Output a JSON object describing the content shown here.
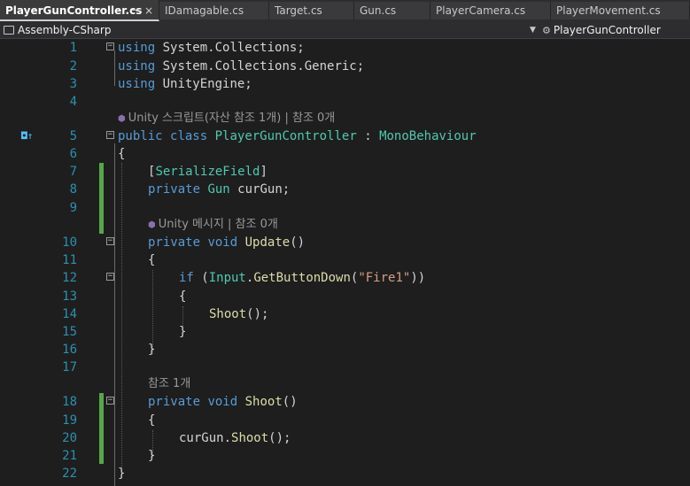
{
  "tabs": [
    {
      "label": "PlayerGunController.cs",
      "active": true,
      "pin": "⊸",
      "close": "×"
    },
    {
      "label": "IDamagable.cs"
    },
    {
      "label": "Target.cs"
    },
    {
      "label": "Gun.cs"
    },
    {
      "label": "PlayerCamera.cs"
    },
    {
      "label": "PlayerMovement.cs"
    }
  ],
  "navbar": {
    "project": "Assembly-CSharp",
    "class_member": "PlayerGunController"
  },
  "editor": {
    "lines": [
      {
        "n": "1"
      },
      {
        "n": "2"
      },
      {
        "n": "3"
      },
      {
        "n": "4"
      },
      {
        "n": "5"
      },
      {
        "n": "6"
      },
      {
        "n": "7"
      },
      {
        "n": "8"
      },
      {
        "n": "9"
      },
      {
        "n": "10"
      },
      {
        "n": "11"
      },
      {
        "n": "12"
      },
      {
        "n": "13"
      },
      {
        "n": "14"
      },
      {
        "n": "15"
      },
      {
        "n": "16"
      },
      {
        "n": "17"
      },
      {
        "n": "18"
      },
      {
        "n": "19"
      },
      {
        "n": "20"
      },
      {
        "n": "21"
      },
      {
        "n": "22"
      }
    ],
    "tokens": {
      "using": "using",
      "ns1": " System.Collections;",
      "ns2": " System.Collections.Generic;",
      "ns3": " UnityEngine;",
      "public": "public",
      "class": "class",
      "class_name": "PlayerGunController",
      "colon": " : ",
      "base_class": "MonoBehaviour",
      "open_brace": "{",
      "close_brace": "}",
      "attr_open": "[",
      "attr_name": "SerializeField",
      "attr_close": "]",
      "private": "private",
      "type_gun": "Gun",
      "field_decl": " curGun;",
      "void": "void",
      "update": "Update",
      "parens": "()",
      "if": "if",
      "if_open": " (",
      "input": "Input",
      "dot": ".",
      "get_button_down": "GetButtonDown",
      "paren_open": "(",
      "fire_str": "\"Fire1\"",
      "if_close": "))",
      "shoot": "Shoot",
      "call_end": "();",
      "cur_gun": "curGun",
      "shoot_decl": "Shoot"
    },
    "codelens": {
      "class_lens": "Unity 스크립트(자산 참조 1개) | 참조 0개",
      "update_lens": "Unity 메시지 | 참조 0개",
      "shoot_lens": "참조 1개"
    }
  },
  "colors": {
    "keyword": "#569cd6",
    "type": "#4ec9b0",
    "string": "#d69d85",
    "method": "#dcdcaa",
    "line_number": "#2b91af",
    "change_bar": "#57a64a",
    "background": "#1e1e1e"
  },
  "icons": {
    "tab_pin": "pin-icon",
    "tab_close": "close-icon",
    "project": "project-icon",
    "dropdown": "chevron-down-icon",
    "class_member": "class-icon",
    "override_marker": "implemented-override-icon",
    "lens_unity": "unity-cube-icon"
  }
}
